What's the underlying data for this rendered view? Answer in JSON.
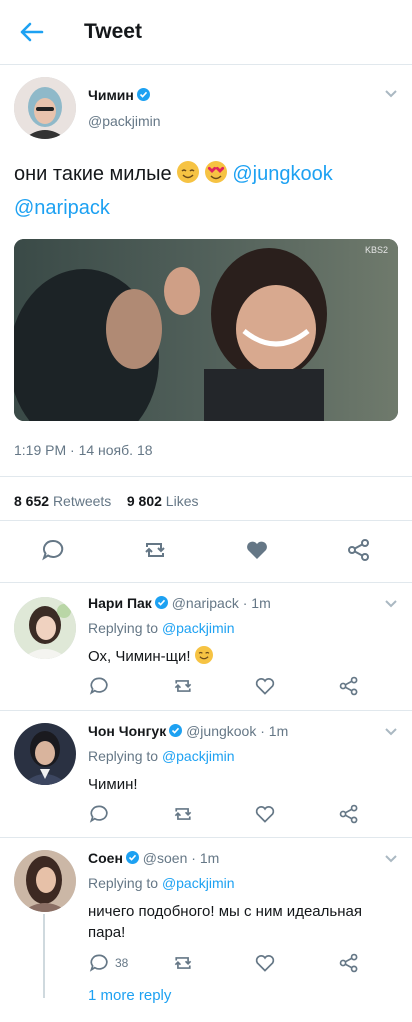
{
  "header": {
    "title": "Tweet"
  },
  "main_tweet": {
    "author_name": "Чимин",
    "author_handle": "@packjimin",
    "text_plain": "они такие милые ",
    "mention_1": "@jungkook",
    "mention_2": "@naripack",
    "video_watermark": "KBS2",
    "timestamp": "1:19 PM · 14 нояб. 18",
    "retweets_count": "8 652",
    "retweets_label": "Retweets",
    "likes_count": "9 802",
    "likes_label": "Likes",
    "liked": true
  },
  "replies": [
    {
      "name": "Нари Пак",
      "handle": "@naripack",
      "time": "· 1m",
      "replying_prefix": "Replying to ",
      "replying_to": "@packjimin",
      "text": "Ох, Чимин-щи!",
      "reply_count": ""
    },
    {
      "name": "Чон Чонгук",
      "handle": "@jungkook",
      "time": "· 1m",
      "replying_prefix": "Replying to ",
      "replying_to": "@packjimin",
      "text": "Чимин!",
      "reply_count": ""
    },
    {
      "name": "Соен",
      "handle": "@soen",
      "time": "· 1m",
      "replying_prefix": "Replying to ",
      "replying_to": "@packjimin",
      "text": "ничего подобного! мы с ним идеальная пара!",
      "reply_count": "38"
    }
  ],
  "more_replies": "1 more reply",
  "colors": {
    "accent": "#1da1f2",
    "muted": "#657786",
    "border": "#e1e8ed",
    "liked_heart": "#657786"
  }
}
